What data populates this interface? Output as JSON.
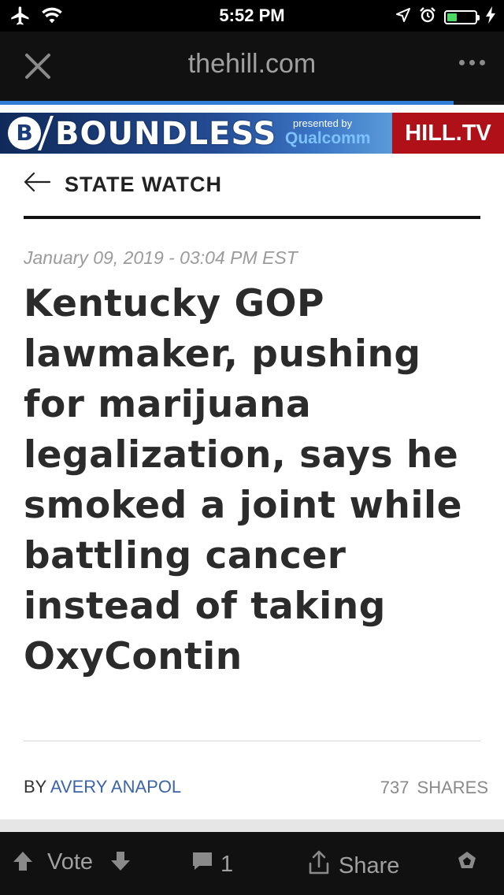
{
  "status_bar": {
    "time": "5:52 PM",
    "icons": [
      "airplane-icon",
      "wifi-icon",
      "location-arrow-icon",
      "alarm-clock-icon",
      "battery-icon",
      "charging-bolt-icon"
    ],
    "battery_level": 0.35,
    "battery_color": "#4cd964"
  },
  "browser": {
    "url": "thehill.com",
    "close_icon": "close-icon",
    "more_icon": "more-icon",
    "load_progress": 0.9,
    "progress_color": "#2f7fd6"
  },
  "banner": {
    "logo_letter": "B",
    "title": "BOUNDLESS",
    "presented_by": "presented by",
    "sponsor": "Qualcomm",
    "hilltv": "HILL.TV",
    "hilltv_color": "#b01018"
  },
  "section": {
    "title": "STATE WATCH",
    "back_icon": "back-arrow-icon"
  },
  "article": {
    "date": "January 09, 2019 - 03:04 PM EST",
    "headline": "Kentucky GOP lawmaker, pushing for marijuana legalization, says he smoked a joint while battling cancer instead of taking OxyContin",
    "byline_prefix": "BY",
    "author": "AVERY ANAPOL",
    "shares_count": "737",
    "shares_label": "SHARES",
    "author_color": "#3c64a8"
  },
  "bottom_bar": {
    "vote_label": "Vote",
    "comment_count": "1",
    "share_label": "Share",
    "icons": [
      "upvote-arrow-icon",
      "downvote-arrow-icon",
      "comment-icon",
      "share-icon",
      "award-icon"
    ]
  }
}
